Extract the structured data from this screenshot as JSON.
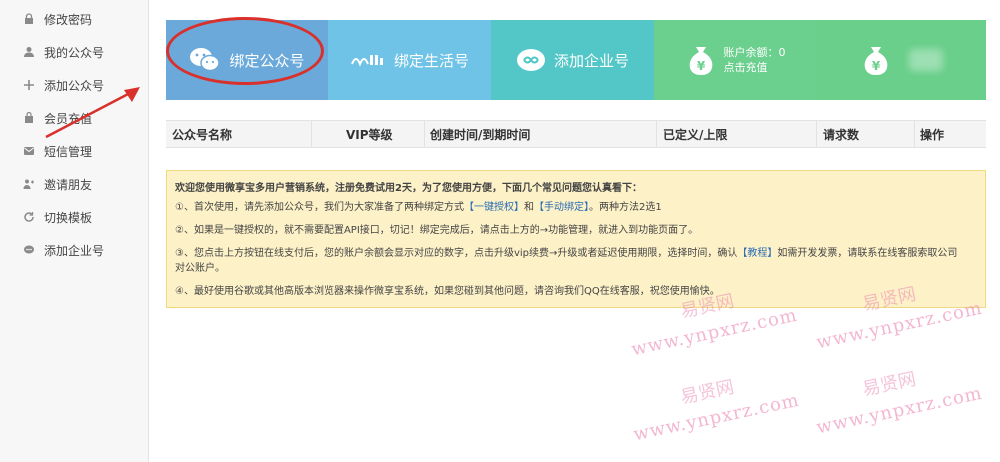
{
  "sidebar": {
    "items": [
      {
        "label": "修改密码",
        "icon": "lock-icon"
      },
      {
        "label": "我的公众号",
        "icon": "user-icon"
      },
      {
        "label": "添加公众号",
        "icon": "plus-icon"
      },
      {
        "label": "会员充值",
        "icon": "bag-icon"
      },
      {
        "label": "短信管理",
        "icon": "message-icon"
      },
      {
        "label": "邀请朋友",
        "icon": "invite-icon"
      },
      {
        "label": "切换模板",
        "icon": "refresh-icon"
      },
      {
        "label": "添加企业号",
        "icon": "chat-icon"
      }
    ]
  },
  "tiles": {
    "wechat": "绑定公众号",
    "life": "绑定生活号",
    "enterprise": "添加企业号",
    "balance_label": "账户余额：0",
    "recharge": "点击充值"
  },
  "table": {
    "headers": [
      "公众号名称",
      "VIP等级",
      "创建时间/到期时间",
      "已定义/上限",
      "请求数",
      "操作"
    ]
  },
  "notice": {
    "title": "欢迎您使用微享宝多用户营销系统，注册免费试用2天，为了您使用方便，下面几个常见问题您认真看下：",
    "l1_a": "①、首次使用，请先添加公众号，我们为大家准备了两种绑定方式",
    "l1_link1": "【一键授权】",
    "l1_b": "和",
    "l1_link2": "【手动绑定】",
    "l1_c": "。两种方法2选1",
    "l2": "②、如果是一键授权的，就不需要配置API接口，切记！绑定完成后，请点击上方的→功能管理，就进入到功能页面了。",
    "l3_a": "③、您点击上方按钮在线支付后，您的账户余额会显示对应的数字，点击升级vip续费→升级或者延迟使用期限，选择时间，确认",
    "l3_link": "【教程】",
    "l3_b": "如需开发发票，请联系在线客服索取公司",
    "l3_c": "对公账户。",
    "l4": "④、最好使用谷歌或其他高版本浏览器来操作微享宝系统，如果您碰到其他问题，请咨询我们QQ在线客服，祝您使用愉快。"
  },
  "watermark": {
    "cn": "易贤网",
    "url": "www.ynpxrz.com"
  },
  "colors": {
    "annotation": "#d9302c",
    "tile_wechat": "#6aa9d9",
    "tile_life": "#6fc3e6",
    "tile_enterprise": "#53c7c7",
    "tile_balance": "#6bcf8e"
  }
}
